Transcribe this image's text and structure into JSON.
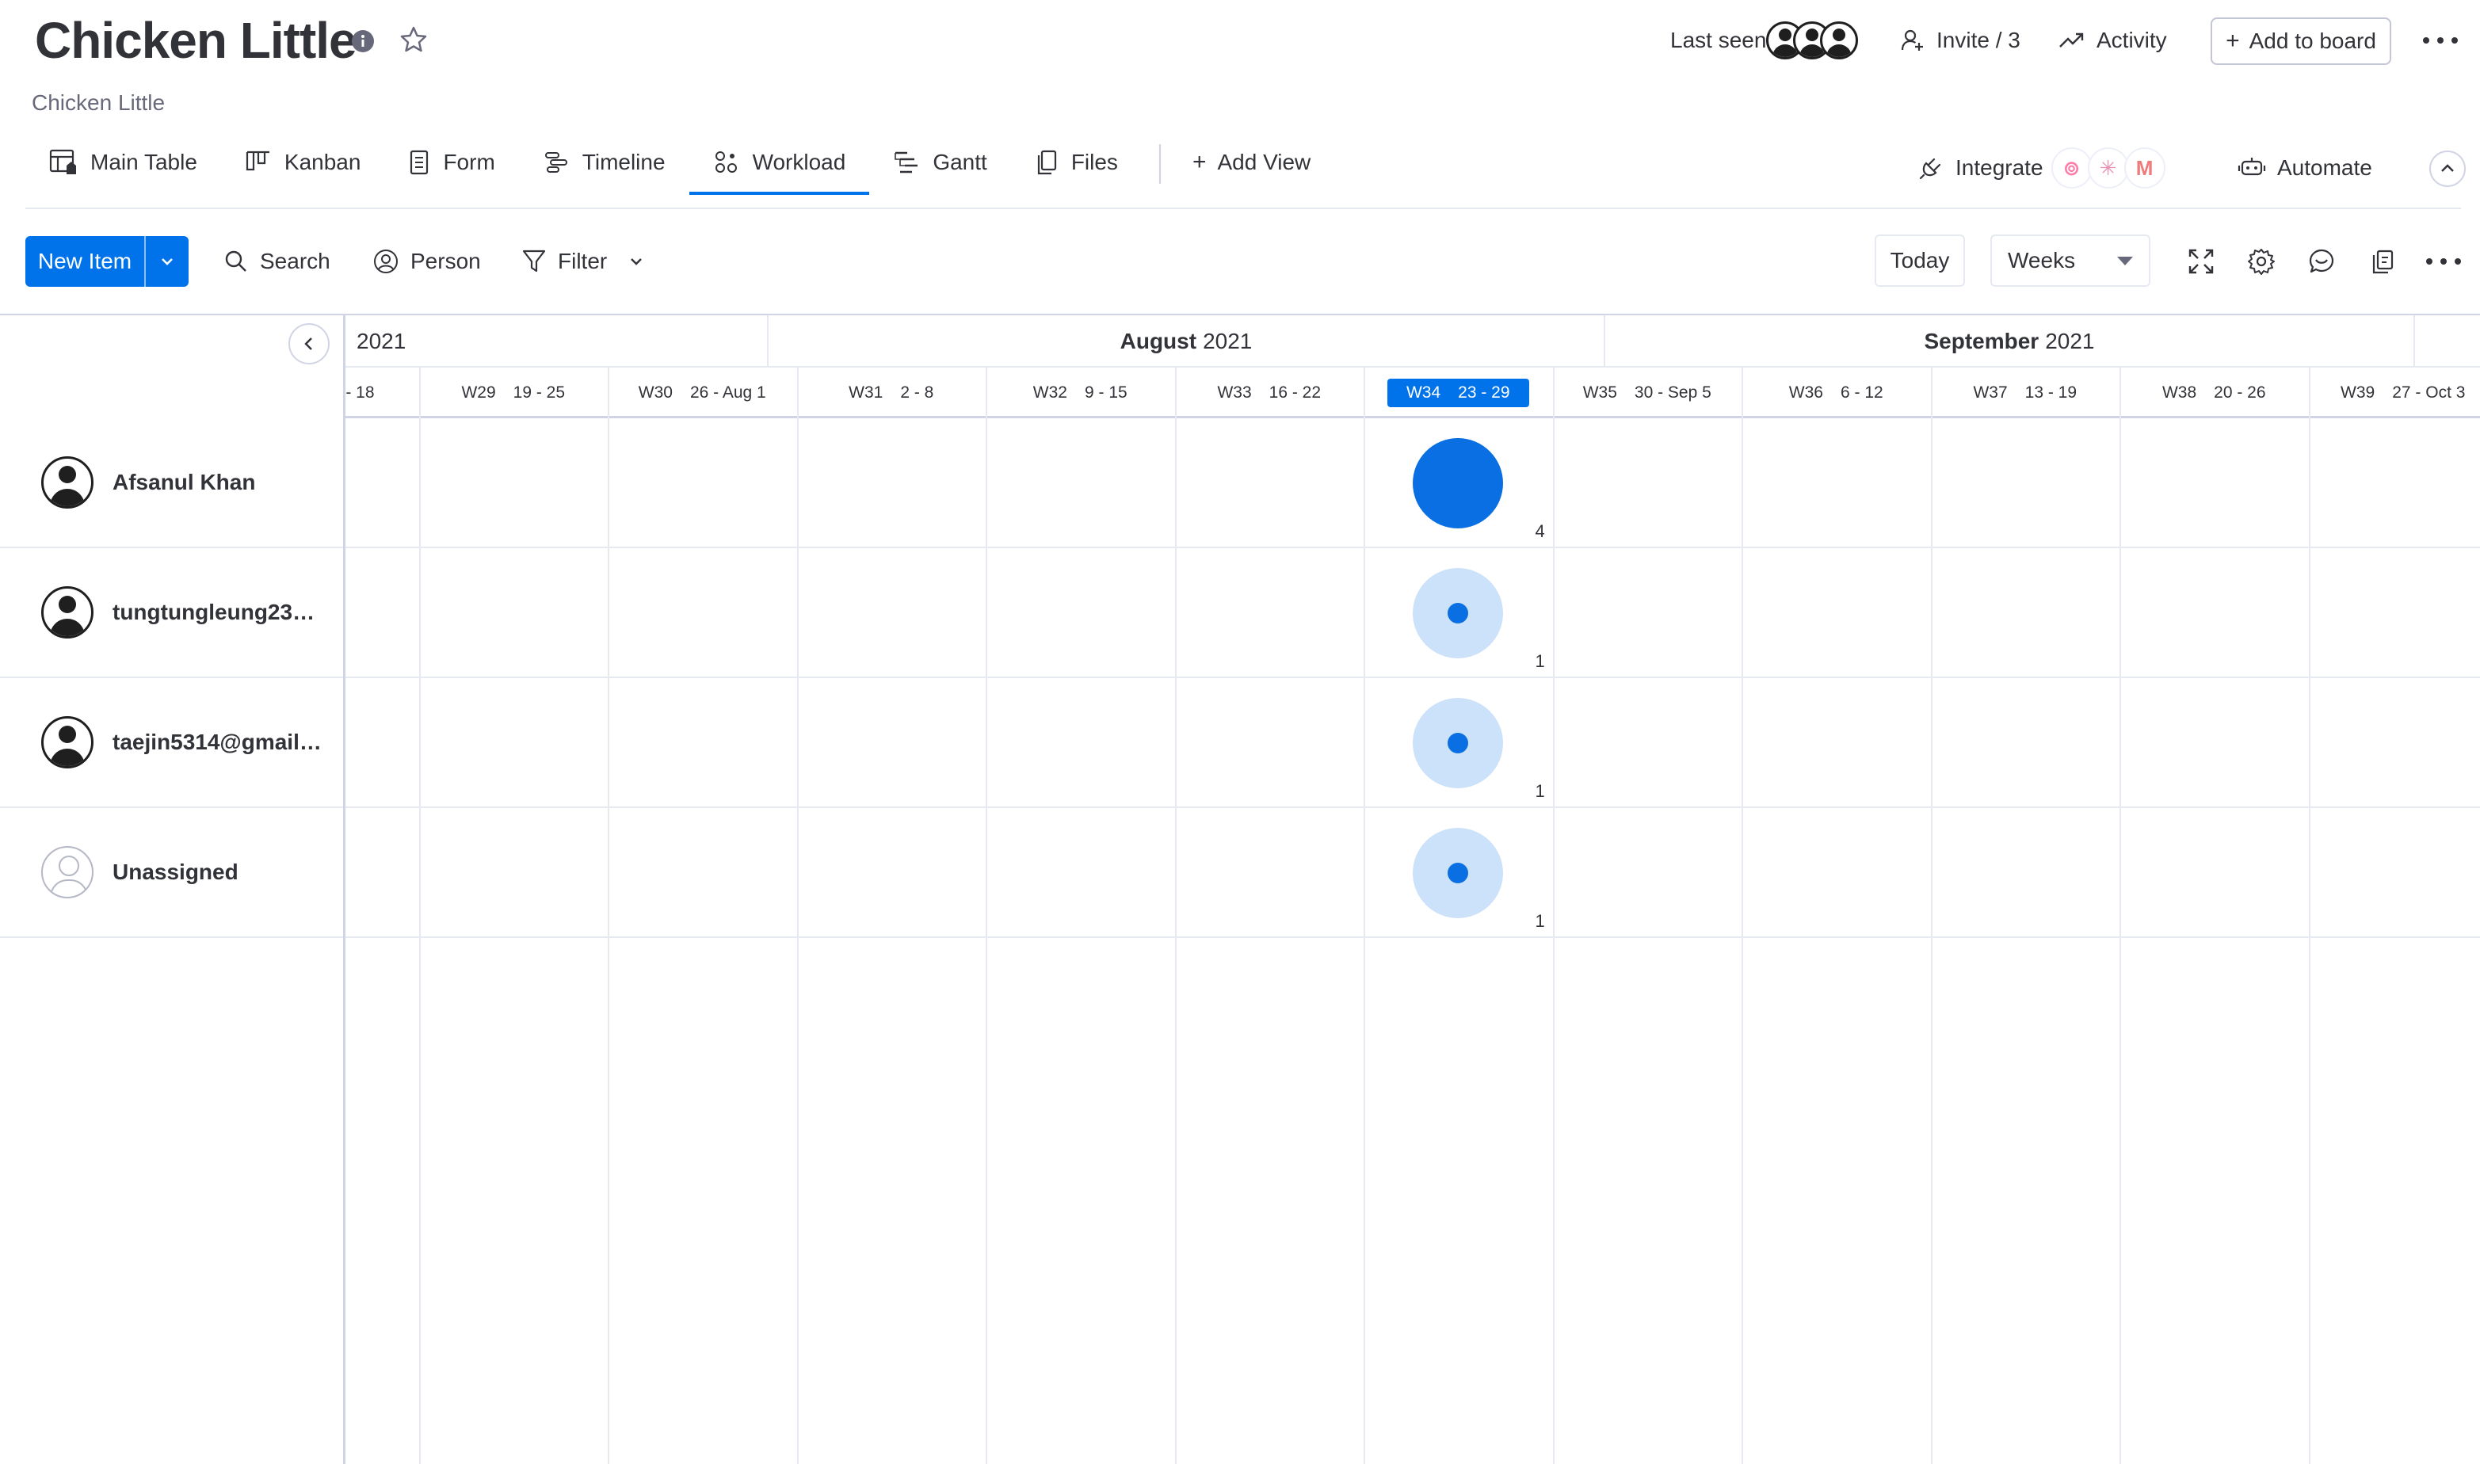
{
  "header": {
    "title": "Chicken Little",
    "subtitle": "Chicken Little",
    "last_seen_label": "Last seen",
    "invite_label": "Invite / 3",
    "activity_label": "Activity",
    "add_to_board_label": "Add to board"
  },
  "tabs": [
    {
      "label": "Main Table",
      "icon": "table-icon"
    },
    {
      "label": "Kanban",
      "icon": "kanban-icon"
    },
    {
      "label": "Form",
      "icon": "form-icon"
    },
    {
      "label": "Timeline",
      "icon": "timeline-icon"
    },
    {
      "label": "Workload",
      "icon": "workload-icon",
      "active": true
    },
    {
      "label": "Gantt",
      "icon": "gantt-icon"
    },
    {
      "label": "Files",
      "icon": "files-icon"
    }
  ],
  "add_view_label": "Add View",
  "integrate_label": "Integrate",
  "automate_label": "Automate",
  "toolbar": {
    "new_item_label": "New Item",
    "search_label": "Search",
    "person_label": "Person",
    "filter_label": "Filter",
    "today_label": "Today",
    "zoom_value": "Weeks"
  },
  "timeline": {
    "months": [
      {
        "name": "",
        "year": "2021"
      },
      {
        "name": "August",
        "year": "2021"
      },
      {
        "name": "September",
        "year": "2021"
      }
    ],
    "weeks": [
      {
        "num": "",
        "range": "- 18"
      },
      {
        "num": "W29",
        "range": "19 - 25"
      },
      {
        "num": "W30",
        "range": "26 - Aug 1"
      },
      {
        "num": "W31",
        "range": "2 - 8"
      },
      {
        "num": "W32",
        "range": "9 - 15"
      },
      {
        "num": "W33",
        "range": "16 - 22"
      },
      {
        "num": "W34",
        "range": "23 - 29",
        "current": true
      },
      {
        "num": "W35",
        "range": "30 - Sep 5"
      },
      {
        "num": "W36",
        "range": "6 - 12"
      },
      {
        "num": "W37",
        "range": "13 - 19"
      },
      {
        "num": "W38",
        "range": "20 - 26"
      },
      {
        "num": "W39",
        "range": "27 - Oct 3"
      }
    ]
  },
  "people": [
    {
      "name": "Afsanul Khan",
      "week": "W34",
      "count": "4",
      "load": "full"
    },
    {
      "name": "tungtungleung233…",
      "week": "W34",
      "count": "1",
      "load": "partial"
    },
    {
      "name": "taejin5314@gmail…",
      "week": "W34",
      "count": "1",
      "load": "partial"
    },
    {
      "name": "Unassigned",
      "week": "W34",
      "count": "1",
      "load": "partial",
      "unassigned": true
    }
  ],
  "colors": {
    "accent": "#0073ea",
    "workload_full": "#0a6fe3",
    "workload_light": "#cce1fa",
    "text": "#323338",
    "border": "#e6e9ef"
  }
}
